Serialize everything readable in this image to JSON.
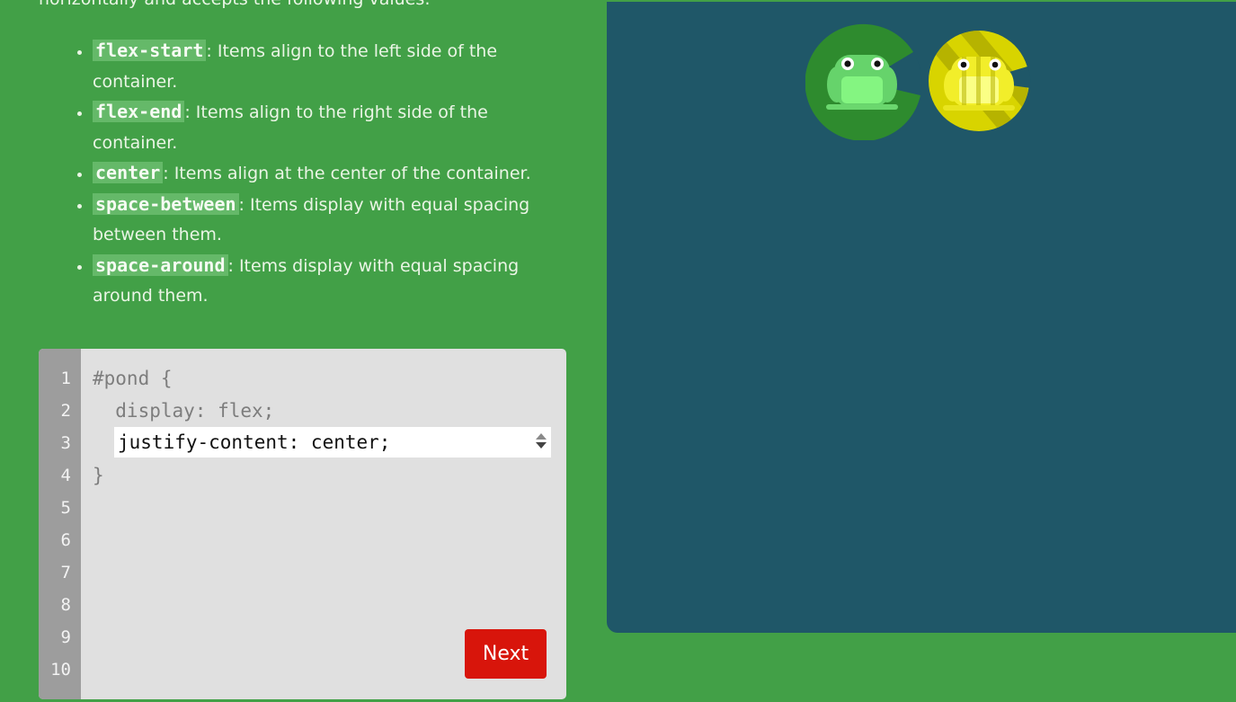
{
  "instructions": {
    "intro": "horizontally and accepts the following values:",
    "options": [
      {
        "keyword": "flex-start",
        "description": ": Items align to the left side of the container."
      },
      {
        "keyword": "flex-end",
        "description": ": Items align to the right side of the container."
      },
      {
        "keyword": "center",
        "description": ": Items align at the center of the container."
      },
      {
        "keyword": "space-between",
        "description": ": Items display with equal spacing between them."
      },
      {
        "keyword": "space-around",
        "description": ": Items display with equal spacing around them."
      }
    ]
  },
  "editor": {
    "line_numbers": [
      "1",
      "2",
      "3",
      "4",
      "5",
      "6",
      "7",
      "8",
      "9",
      "10"
    ],
    "line1": "#pond {",
    "line2": "  display: flex;",
    "answer_value": "justify-content: center;",
    "line4": "}",
    "next_label": "Next"
  },
  "board": {
    "lilypads": [
      "green-lilypad",
      "yellow-lilypad"
    ],
    "frogs": [
      "green-frog",
      "yellow-frog"
    ]
  },
  "colors": {
    "background": "#42a047",
    "pond": "#1f5768",
    "editor": "#e0e0e0",
    "gutter": "#9d9d9d",
    "next_button": "#d8150b",
    "green_lily": "#2e8b2e",
    "yellow_lily": "#d8d400"
  }
}
